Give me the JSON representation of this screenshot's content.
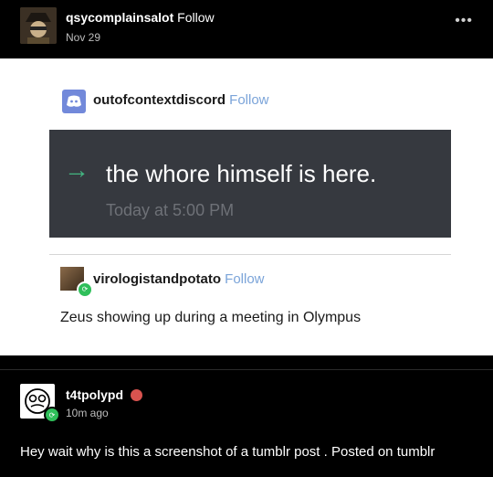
{
  "post": {
    "author": "qsycomplainsalot",
    "follow_label": "Follow",
    "date": "Nov 29"
  },
  "embedded_image": {
    "op_name": "outofcontextdiscord",
    "op_follow_label": "Follow",
    "discord_message": "the whore himself is here.",
    "discord_time": "Today at 5:00 PM",
    "reply_name": "virologistandpotato",
    "reply_follow_label": "Follow",
    "reply_text": "Zeus showing up during a meeting in Olympus"
  },
  "reblog": {
    "author": "t4tpolypd",
    "time": "10m ago",
    "text": "Hey wait why is this a screenshot of a tumblr post . Posted on tumblr"
  },
  "icons": {
    "more": "more-options-icon",
    "arrow": "arrow-right-icon",
    "reblog_badge": "reblog-icon",
    "gift": "gift-badge-icon"
  },
  "colors": {
    "background": "#000000",
    "discord_bg": "#36393f",
    "discord_arrow": "#43b581",
    "follow_link": "#7ba4d9"
  }
}
